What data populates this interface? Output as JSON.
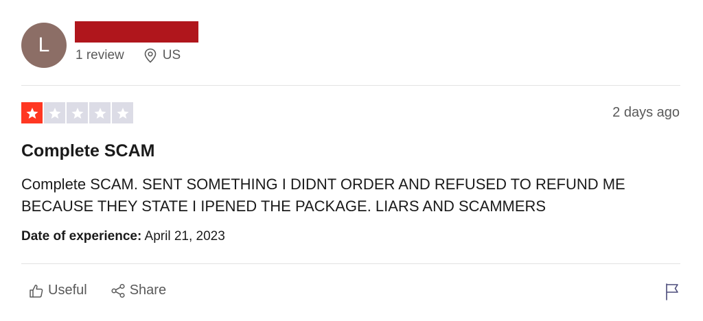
{
  "reviewer": {
    "avatar_initial": "L",
    "review_count": "1 review",
    "location": "US",
    "name_redaction_color": "#b0161c",
    "avatar_color": "#8c6e66"
  },
  "review": {
    "rating": 1,
    "max_rating": 5,
    "date": "2 days ago",
    "title": "Complete SCAM",
    "body": "Complete SCAM. SENT SOMETHING I DIDNT ORDER AND REFUSED TO REFUND ME BECAUSE THEY STATE I IPENED THE PACKAGE. LIARS AND SCAMMERS",
    "experience_label": "Date of experience:",
    "experience_date": "April 21, 2023"
  },
  "actions": {
    "useful_label": "Useful",
    "share_label": "Share"
  },
  "colors": {
    "star_filled": "#ff3722",
    "star_empty": "#dcdce6",
    "muted_text": "#595959"
  },
  "icons": [
    "location-pin-icon",
    "star-icon",
    "thumbs-up-icon",
    "share-icon",
    "flag-icon"
  ]
}
